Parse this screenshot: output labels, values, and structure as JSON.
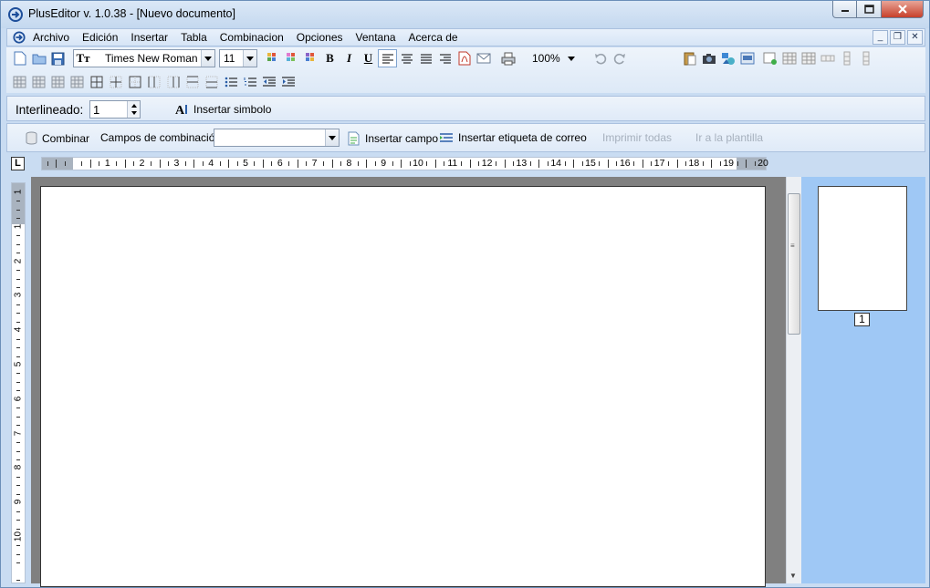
{
  "window": {
    "title": "PlusEditor v. 1.0.38 - [Nuevo documento]"
  },
  "menu": {
    "items": [
      "Archivo",
      "Edición",
      "Insertar",
      "Tabla",
      "Combinacion",
      "Opciones",
      "Ventana",
      "Acerca de"
    ],
    "mdi": {
      "minimize": "_",
      "restore": "❐",
      "close": "✕"
    }
  },
  "toolbar": {
    "font": "Times New Roman",
    "font_size": "11",
    "zoom": "100%"
  },
  "format_bar": {
    "interlineado_label": "Interlineado:",
    "interlineado_value": "1",
    "insert_symbol": "Insertar simbolo"
  },
  "merge_bar": {
    "combinar": "Combinar",
    "campos_label": "Campos de combinación",
    "campos_value": "",
    "insertar_campo": "Insertar campo",
    "insertar_etiqueta": "Insertar etiqueta de correo",
    "imprimir_todas": "Imprimir todas",
    "ir_plantilla": "Ir a la plantilla"
  },
  "ruler": {
    "tab_selector": "L",
    "numbers": [
      "1",
      "2",
      "3",
      "4",
      "5",
      "6",
      "7",
      "8",
      "9",
      "10",
      "11",
      "12",
      "13",
      "14",
      "15",
      "16",
      "17",
      "18",
      "19",
      "20"
    ],
    "vertical_numbers": [
      "1",
      "1",
      "2",
      "3",
      "4",
      "5",
      "6",
      "7",
      "8",
      "9",
      "10"
    ]
  },
  "thumbnails": {
    "page_number": "1"
  },
  "colors": {
    "accent": "#c9dcf2",
    "thumb_panel": "#9fc8f5",
    "doc_background": "#808080"
  }
}
